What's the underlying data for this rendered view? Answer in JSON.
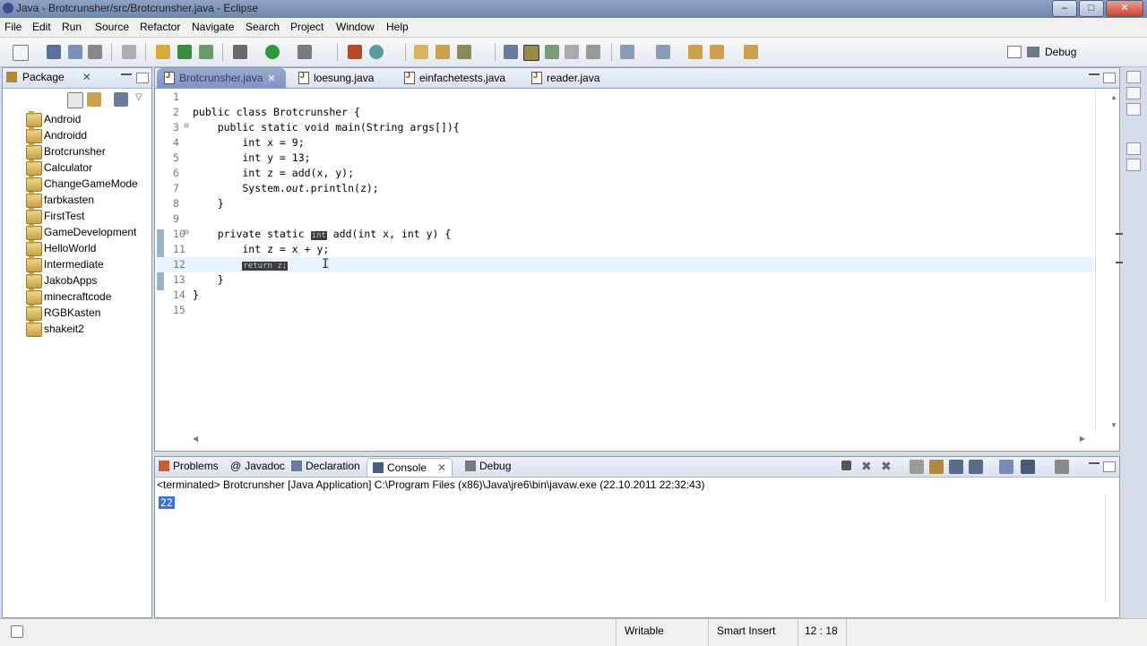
{
  "window": {
    "title": "Java - Brotcrunsher/src/Brotcrunsher.java - Eclipse",
    "buttons": [
      "–",
      "□",
      "✕"
    ]
  },
  "menu": [
    "File",
    "Edit",
    "Run",
    "Source",
    "Refactor",
    "Navigate",
    "Search",
    "Project",
    "Window",
    "Help"
  ],
  "toolbar": {
    "perspective_label": "Debug"
  },
  "package_explorer": {
    "tab_label": "Package",
    "projects": [
      "Android",
      "Androidd",
      "Brotcrunsher",
      "Calculator",
      "ChangeGameMode",
      "farbkasten",
      "FirstTest",
      "GameDevelopment",
      "HelloWorld",
      "Intermediate",
      "JakobApps",
      "minecraftcode",
      "RGBKasten",
      "shakeit2"
    ]
  },
  "editor": {
    "tabs": [
      {
        "label": "Brotcrunsher.java",
        "active": true
      },
      {
        "label": "loesung.java",
        "active": false
      },
      {
        "label": "einfachetests.java",
        "active": false
      },
      {
        "label": "reader.java",
        "active": false
      }
    ],
    "lines": [
      {
        "num": "1",
        "code": ""
      },
      {
        "num": "2",
        "code": "public class Brotcrunsher {"
      },
      {
        "num": "3",
        "fold": "⊖",
        "code": "    public static void main(String args[]){"
      },
      {
        "num": "4",
        "code": "        int x = 9;"
      },
      {
        "num": "5",
        "code": "        int y = 13;"
      },
      {
        "num": "6",
        "code": "        int z = add(x, y);"
      },
      {
        "num": "7",
        "code_pre": "        System.",
        "code_italic": "out",
        "code_post": ".println(z);"
      },
      {
        "num": "8",
        "code": "    }"
      },
      {
        "num": "9",
        "code": ""
      },
      {
        "num": "10",
        "fold": "⊖",
        "code_pre": "    private static ",
        "code_sel": "int",
        "code_post": " add(int x, int y) {"
      },
      {
        "num": "11",
        "code": "        int z = x + y;"
      },
      {
        "num": "12",
        "code_pre": "        ",
        "code_sel": "return z;",
        "code_post": "",
        "current": true
      },
      {
        "num": "13",
        "code": "    }"
      },
      {
        "num": "14",
        "code": "}"
      },
      {
        "num": "15",
        "code": ""
      }
    ]
  },
  "bottom_panel": {
    "tabs": [
      {
        "label": "Problems",
        "icon": "problems-icon"
      },
      {
        "label": "Javadoc",
        "icon": "javadoc-icon"
      },
      {
        "label": "Declaration",
        "icon": "declaration-icon"
      },
      {
        "label": "Console",
        "icon": "console-icon",
        "active": true
      },
      {
        "label": "Debug",
        "icon": "debug-icon"
      }
    ],
    "console_header": "<terminated> Brotcrunsher [Java Application] C:\\Program Files (x86)\\Java\\jre6\\bin\\javaw.exe (22.10.2011 22:32:43)",
    "output": "22"
  },
  "status": {
    "writable": "Writable",
    "insert_mode": "Smart Insert",
    "position": "12 : 18"
  },
  "colors": {
    "active_tab": "#8ea1c9",
    "selection": "#3875d7",
    "current_line": "#e8f2fe"
  }
}
